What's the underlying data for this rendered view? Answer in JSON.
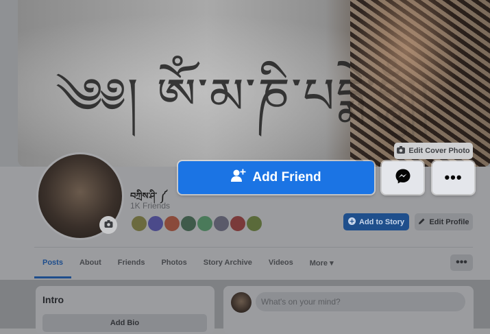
{
  "cover": {
    "script_text": "༄༅། ཨོཾ་མ་ཎི་པདྨེ་ཧཱུྃ།།",
    "edit_cover_label": "Edit Cover Photo"
  },
  "profile": {
    "name": "བཀྲིས་ཤི་ ༼",
    "friends_count": "1K Friends"
  },
  "actions": {
    "add_friend_label": "Add Friend",
    "add_to_story_label": "Add to Story",
    "edit_profile_label": "Edit Profile",
    "more_label": "•••"
  },
  "tabs": [
    {
      "label": "Posts",
      "active": true
    },
    {
      "label": "About"
    },
    {
      "label": "Friends"
    },
    {
      "label": "Photos"
    },
    {
      "label": "Story Archive"
    },
    {
      "label": "Videos"
    },
    {
      "label": "More ▾"
    }
  ],
  "tabs_more_button": "•••",
  "intro": {
    "title": "Intro",
    "add_bio_label": "Add Bio"
  },
  "composer": {
    "placeholder": "What's on your mind?"
  },
  "colors": {
    "primary_blue": "#1b74e4",
    "secondary_button": "#e4e6eb"
  },
  "friend_avatar_colors": [
    "#6b6a3f",
    "#4b4a8a",
    "#8a4a3a",
    "#3f5a4a",
    "#4a7a5a",
    "#5a5a6a",
    "#7a3a3a",
    "#5a6a3a"
  ]
}
